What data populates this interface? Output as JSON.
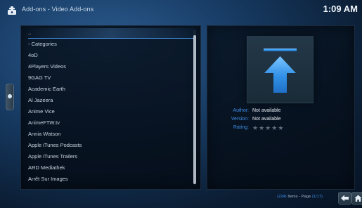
{
  "header": {
    "title": "Add-ons - Video Add-ons",
    "time": "1:09 AM"
  },
  "list": {
    "items": [
      "..",
      "- Categories",
      "4oD",
      "4Players Videos",
      "9GAG TV",
      "Academic Earth",
      "Al Jazeera",
      "Anime Vice",
      "AnimeFTW.tv",
      "Annia Watson",
      "Apple iTunes Podcasts",
      "Apple iTunes Trailers",
      "ARD Mediathek",
      "Arrêt Sur Images"
    ],
    "selected_index": 0
  },
  "details": {
    "author_label": "Author:",
    "author_value": "Not available",
    "version_label": "Version:",
    "version_value": "Not available",
    "rating_label": "Rating:",
    "rating": 0,
    "rating_max": 5,
    "thumbnail_icon": "upload-arrow-icon"
  },
  "footer": {
    "items_count": "(224)",
    "items_label": "Items - Page",
    "page": "(1/17)",
    "back_icon": "back-arrow-icon",
    "home_icon": "home-icon"
  },
  "colors": {
    "accent": "#3d8ee6",
    "background": "#173b63",
    "panel": "#07121f"
  }
}
